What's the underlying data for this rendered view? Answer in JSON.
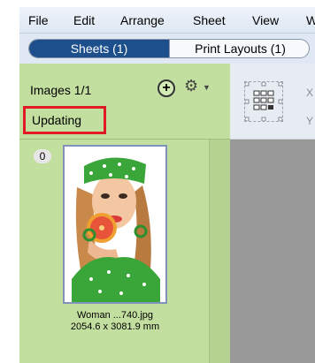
{
  "menubar": {
    "items": [
      "File",
      "Edit",
      "Arrange",
      "Sheet",
      "View",
      "W"
    ]
  },
  "tabs": {
    "sheets_label": "Sheets (1)",
    "print_layouts_label": "Print Layouts (1)"
  },
  "panel": {
    "images_count": "Images 1/1",
    "status_text": "Updating"
  },
  "thumbnail": {
    "badge": "0",
    "filename": "Woman ...740.jpg",
    "dimensions": "2054.6 x 3081.9 mm"
  },
  "toolbar": {
    "x_label": "X",
    "y_label": "Y"
  },
  "colors": {
    "panel_bg": "#c3dfa0",
    "active_tab": "#1c4f8c",
    "status_highlight": "#e01b24",
    "canvas": "#999999"
  }
}
